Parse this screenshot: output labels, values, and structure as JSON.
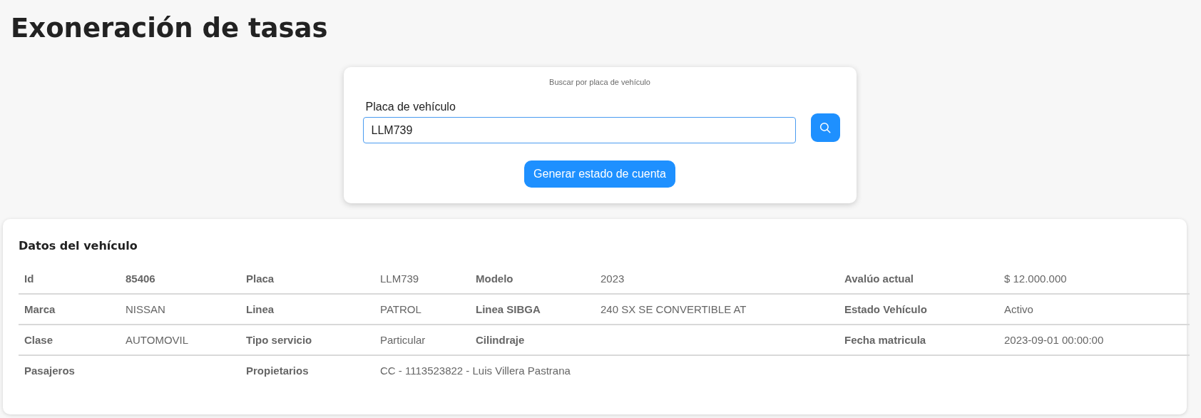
{
  "page_title": "Exoneración de tasas",
  "search_card": {
    "caption": "Buscar por placa de vehículo",
    "field_label": "Placa de vehículo",
    "field_value": "LLM739",
    "generate_button": "Generar estado de cuenta"
  },
  "vehicle_card": {
    "title": "Datos del vehículo",
    "rows": [
      [
        {
          "label": "Id",
          "value": "85406",
          "strong": true
        },
        {
          "label": "Placa",
          "value": "LLM739",
          "strong": false
        },
        {
          "label": "Modelo",
          "value": "2023",
          "strong": false
        },
        {
          "label": "Avalúo actual",
          "value": "$ 12.000.000",
          "strong": false
        }
      ],
      [
        {
          "label": "Marca",
          "value": "NISSAN",
          "strong": false
        },
        {
          "label": "Linea",
          "value": "PATROL",
          "strong": false
        },
        {
          "label": "Linea SIBGA",
          "value": "240 SX SE CONVERTIBLE AT",
          "strong": false
        },
        {
          "label": "Estado Vehículo",
          "value": "Activo",
          "strong": false
        }
      ],
      [
        {
          "label": "Clase",
          "value": "AUTOMOVIL",
          "strong": false
        },
        {
          "label": "Tipo servicio",
          "value": "Particular",
          "strong": false
        },
        {
          "label": "Cilindraje"
        },
        {
          "label": "Fecha matricula",
          "value": "2023-09-01 00:00:00",
          "strong": false
        }
      ],
      [
        {
          "label": "Pasajeros"
        },
        {
          "label": "Propietarios",
          "value": "CC - 1113523822 - Luis Villera Pastrana",
          "strong": false
        }
      ]
    ]
  }
}
